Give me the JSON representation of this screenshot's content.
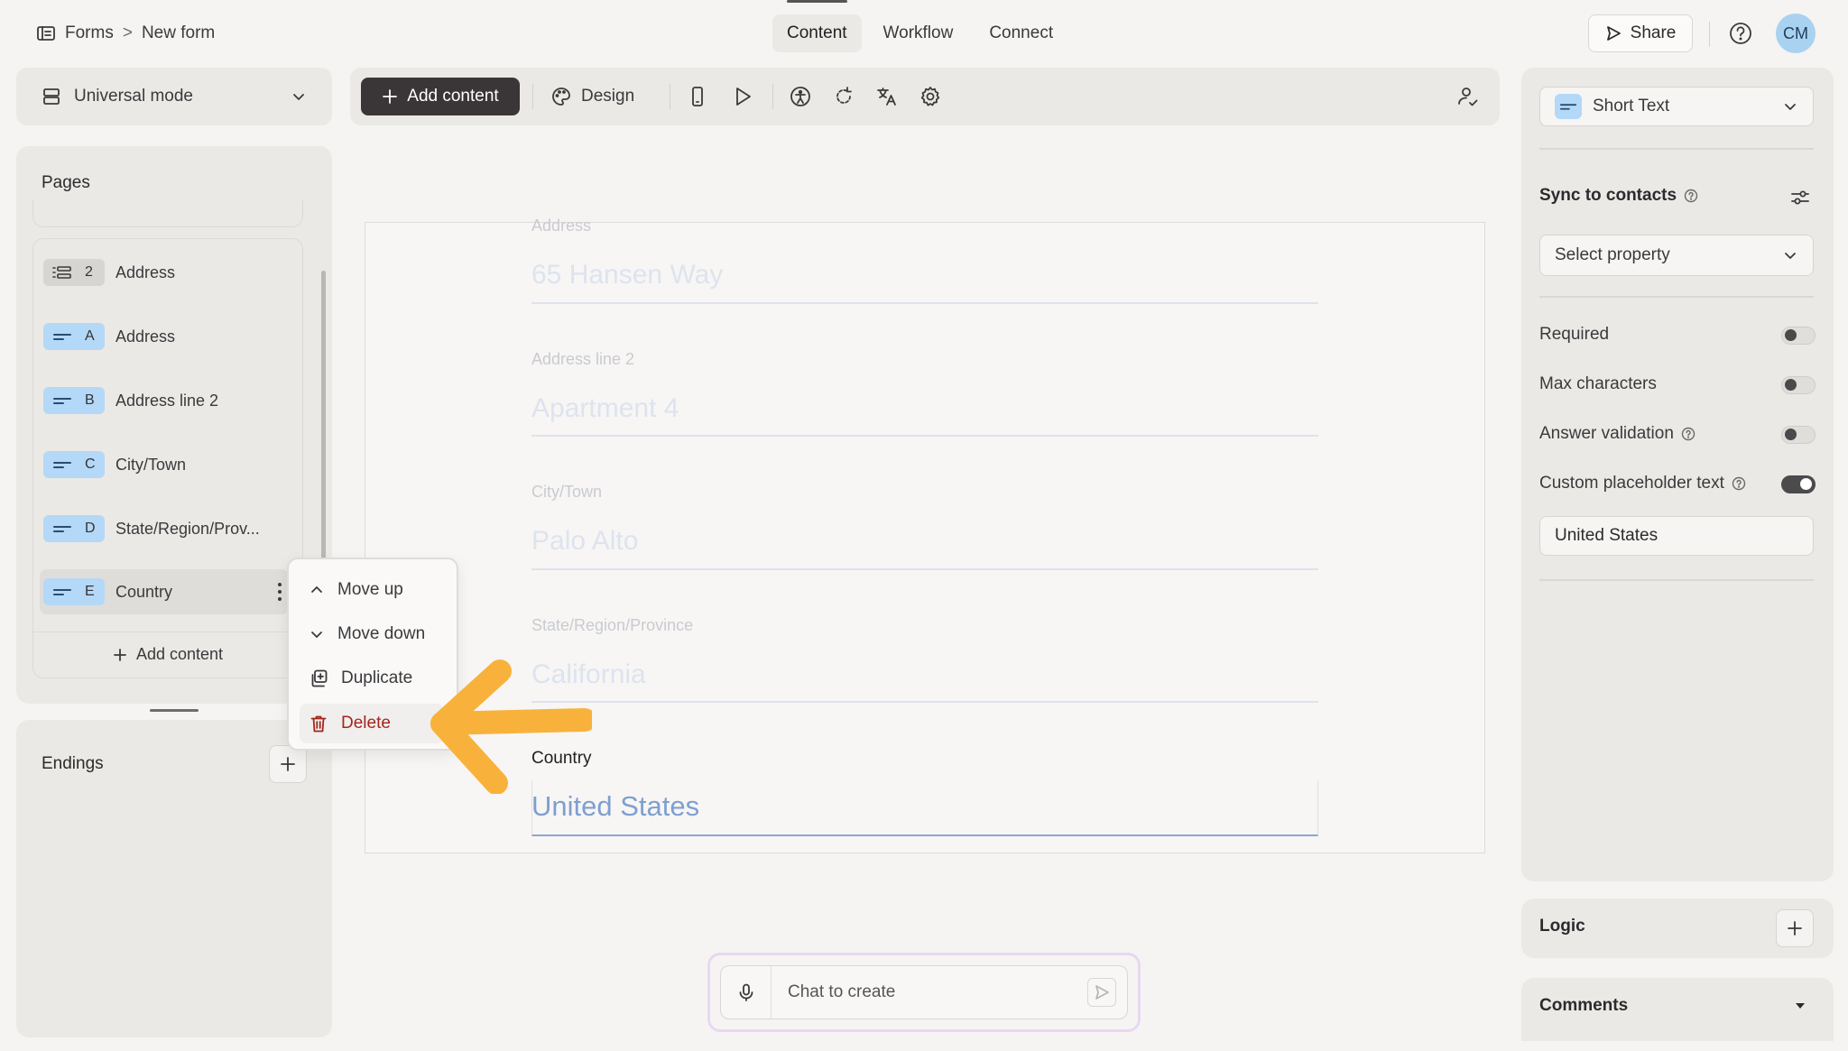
{
  "header": {
    "breadcrumb": {
      "root": "Forms",
      "separator": ">",
      "current": "New form"
    },
    "tabs": [
      {
        "label": "Content",
        "active": true
      },
      {
        "label": "Workflow",
        "active": false
      },
      {
        "label": "Connect",
        "active": false
      }
    ],
    "share_label": "Share",
    "avatar_initials": "CM"
  },
  "left": {
    "mode_label": "Universal mode",
    "pages_title": "Pages",
    "items": [
      {
        "badge": "2",
        "label": "Address",
        "kind": "group"
      },
      {
        "badge": "A",
        "label": "Address",
        "kind": "short-text"
      },
      {
        "badge": "B",
        "label": "Address line 2",
        "kind": "short-text"
      },
      {
        "badge": "C",
        "label": "City/Town",
        "kind": "short-text"
      },
      {
        "badge": "D",
        "label": "State/Region/Prov...",
        "kind": "short-text"
      },
      {
        "badge": "E",
        "label": "Country",
        "kind": "short-text",
        "selected": true
      }
    ],
    "add_content_label": "Add content",
    "endings_title": "Endings"
  },
  "toolbar": {
    "add_content_label": "Add content",
    "design_label": "Design"
  },
  "canvas": {
    "fields": [
      {
        "label": "Address",
        "placeholder": "65 Hansen Way"
      },
      {
        "label": "Address line 2",
        "placeholder": "Apartment 4"
      },
      {
        "label": "City/Town",
        "placeholder": "Palo Alto"
      },
      {
        "label": "State/Region/Province",
        "placeholder": "California"
      }
    ],
    "active_field": {
      "label": "Country",
      "placeholder": "United States"
    }
  },
  "context_menu": {
    "items": [
      {
        "label": "Move up",
        "icon": "chevron-up-icon"
      },
      {
        "label": "Move down",
        "icon": "chevron-down-icon"
      },
      {
        "label": "Duplicate",
        "icon": "duplicate-icon"
      },
      {
        "label": "Delete",
        "icon": "trash-icon",
        "danger": true
      }
    ]
  },
  "chat": {
    "placeholder": "Chat to create"
  },
  "right": {
    "question_type": "Short Text",
    "sync_title": "Sync to contacts",
    "select_property": "Select property",
    "options": [
      {
        "label": "Required",
        "help": false,
        "enabled": false
      },
      {
        "label": "Max characters",
        "help": false,
        "enabled": false
      },
      {
        "label": "Answer validation",
        "help": true,
        "enabled": false
      },
      {
        "label": "Custom placeholder text",
        "help": true,
        "enabled": true
      }
    ],
    "placeholder_value": "United States",
    "logic_title": "Logic",
    "comments_title": "Comments"
  },
  "colors": {
    "accent_arrow": "#f8b23c",
    "badge_blue": "#b4d8f7",
    "danger": "#a3261d",
    "primary_button": "#3a3536"
  }
}
